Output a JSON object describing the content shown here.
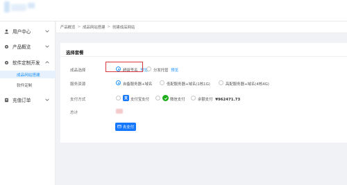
{
  "sidebar": {
    "items": [
      {
        "label": "用户中心",
        "icon": "user-icon"
      },
      {
        "label": "产品概览",
        "icon": "gear-icon"
      },
      {
        "label": "软件定制开发",
        "icon": "gear-icon"
      },
      {
        "label": "充值订单",
        "icon": "order-icon"
      }
    ],
    "sub_items": [
      {
        "label": "成品网站搭建",
        "active": true
      },
      {
        "label": "软件定制",
        "active": false
      }
    ]
  },
  "breadcrumb": [
    "产品概览",
    "成品网站搭建",
    "创建成品网站"
  ],
  "card": {
    "title": "选择套餐",
    "product": {
      "label": "成品选择",
      "options": [
        {
          "text": "超级签名",
          "link": "预览",
          "checked": true
        },
        {
          "text": "分发托管",
          "link": "预览",
          "checked": false
        }
      ]
    },
    "server": {
      "label": "服务资源",
      "options": [
        {
          "text": "自备服务器+域名",
          "checked": true
        },
        {
          "text": "低配服务器+域名(1核1G)",
          "checked": false
        },
        {
          "text": "高配服务器+域名(4核4G)",
          "checked": false
        }
      ]
    },
    "payment": {
      "label": "支付方式",
      "options": [
        {
          "text": "支付宝支付",
          "icon": "alipay-icon",
          "checked": false
        },
        {
          "text": "微信支付",
          "icon": "wechat-icon",
          "checked": false
        },
        {
          "text": "余额支付",
          "amount": "¥962471.73",
          "checked": false
        }
      ]
    },
    "total": {
      "label": "总计"
    },
    "pay_button": "去支付"
  },
  "colors": {
    "primary": "#1890ff",
    "highlight": "#d9363e",
    "alipay": "#1677ff",
    "wechat": "#1aad19"
  }
}
